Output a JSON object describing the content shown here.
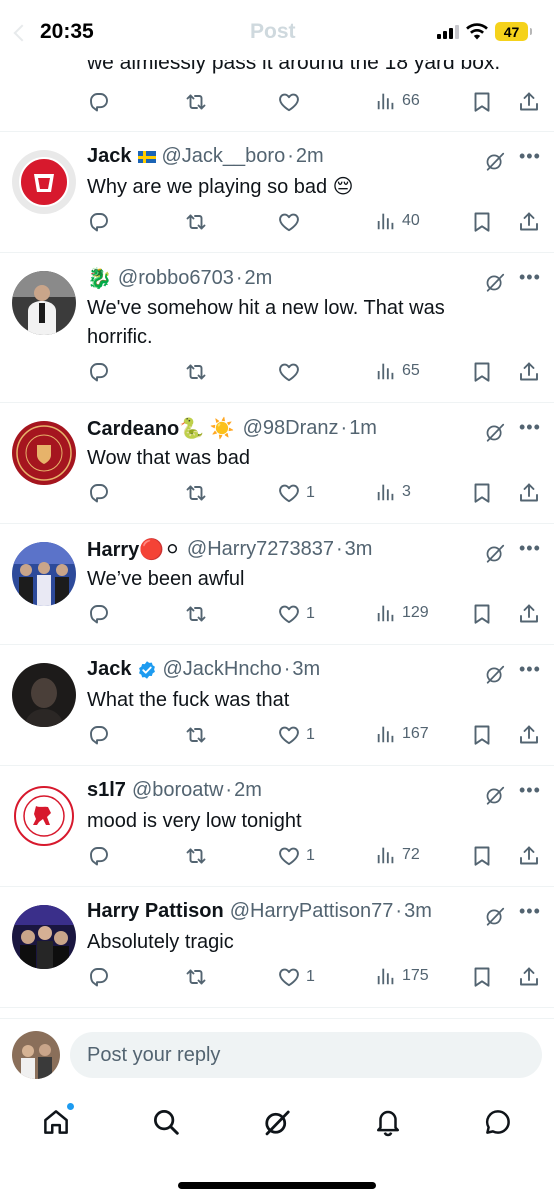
{
  "status_bar": {
    "time": "20:35",
    "faded_title": "Post",
    "battery": "47"
  },
  "partial_tweet": {
    "text": "we aimlessly pass it around the 18 yard box.",
    "views": "66"
  },
  "tweets": [
    {
      "name": "Jack",
      "name_emoji": "swedish-flag",
      "handle": "@Jack__boro",
      "time": "2m",
      "text": "Why are we playing so bad 😔",
      "replies": "",
      "retweets": "",
      "likes": "",
      "views": "40"
    },
    {
      "name": "🐉",
      "handle": "@robbo6703",
      "time": "2m",
      "text": "We've somehow hit a new low. That was horrific.",
      "replies": "",
      "retweets": "",
      "likes": "",
      "views": "65"
    },
    {
      "name": "Cardeano🐍 ☀️",
      "handle": "@98Dranz",
      "time": "1m",
      "text": "Wow that was bad",
      "replies": "",
      "retweets": "",
      "likes": "1",
      "views": "3"
    },
    {
      "name": "Harry🔴⚪",
      "handle": "@Harry7273837",
      "time": "3m",
      "text": "We’ve been awful",
      "replies": "",
      "retweets": "",
      "likes": "1",
      "views": "129"
    },
    {
      "name": "Jack",
      "verified": true,
      "handle": "@JackHncho",
      "time": "3m",
      "text": "What the fuck was that",
      "replies": "",
      "retweets": "",
      "likes": "1",
      "views": "167"
    },
    {
      "name": "s1l7",
      "handle": "@boroatw",
      "time": "2m",
      "text": "mood is very low tonight",
      "replies": "",
      "retweets": "",
      "likes": "1",
      "views": "72"
    },
    {
      "name": "Harry Pattison",
      "handle": "@HarryPattison77",
      "time": "3m",
      "text": "Absolutely tragic",
      "replies": "",
      "retweets": "",
      "likes": "1",
      "views": "175"
    }
  ],
  "reply_bar": {
    "placeholder": "Post your reply"
  },
  "nav": {
    "items": [
      "home-icon",
      "search-icon",
      "grok-icon",
      "notifications-icon",
      "messages-icon"
    ],
    "accent": "#1d9bf0"
  },
  "colors": {
    "text": "#0f1419",
    "secondary": "#536471",
    "divider": "#eff3f4",
    "middlesbrough_red": "#d7192d"
  }
}
